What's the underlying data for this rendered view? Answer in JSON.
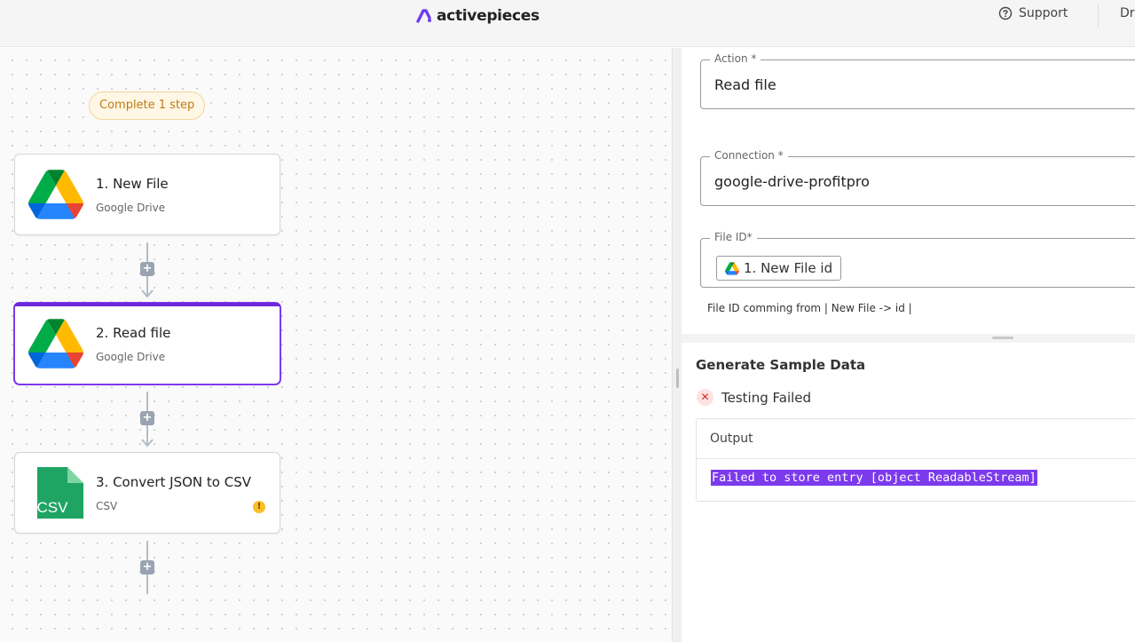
{
  "header": {
    "logo_text": "activepieces",
    "support_label": "Support",
    "extra_label": "Dr"
  },
  "canvas": {
    "pill_label": "Complete 1 step",
    "steps": [
      {
        "title": "1. New File",
        "subtitle": "Google Drive",
        "icon": "google-drive-icon"
      },
      {
        "title": "2. Read file",
        "subtitle": "Google Drive",
        "icon": "google-drive-icon",
        "selected": true
      },
      {
        "title": "3. Convert JSON to CSV",
        "subtitle": "CSV",
        "icon": "csv-file-icon",
        "warning": true
      }
    ],
    "csv_icon_text": "CSV",
    "add_step_glyph": "+"
  },
  "panel": {
    "action": {
      "label": "Action *",
      "value": "Read file"
    },
    "connection": {
      "label": "Connection *",
      "value": "google-drive-profitpro"
    },
    "file_id": {
      "label": "File ID*",
      "chip": "1. New File id"
    },
    "hint": "File ID comming from | New File -> id |",
    "sample": {
      "title": "Generate Sample Data",
      "status": "Testing Failed",
      "output_label": "Output",
      "output_text": "Failed to store entry [object ReadableStream]"
    }
  },
  "colors": {
    "accent": "#7c3aed",
    "warning": "#fbbf24",
    "error": "#d32f2f",
    "pill_bg": "#fff7e6"
  }
}
